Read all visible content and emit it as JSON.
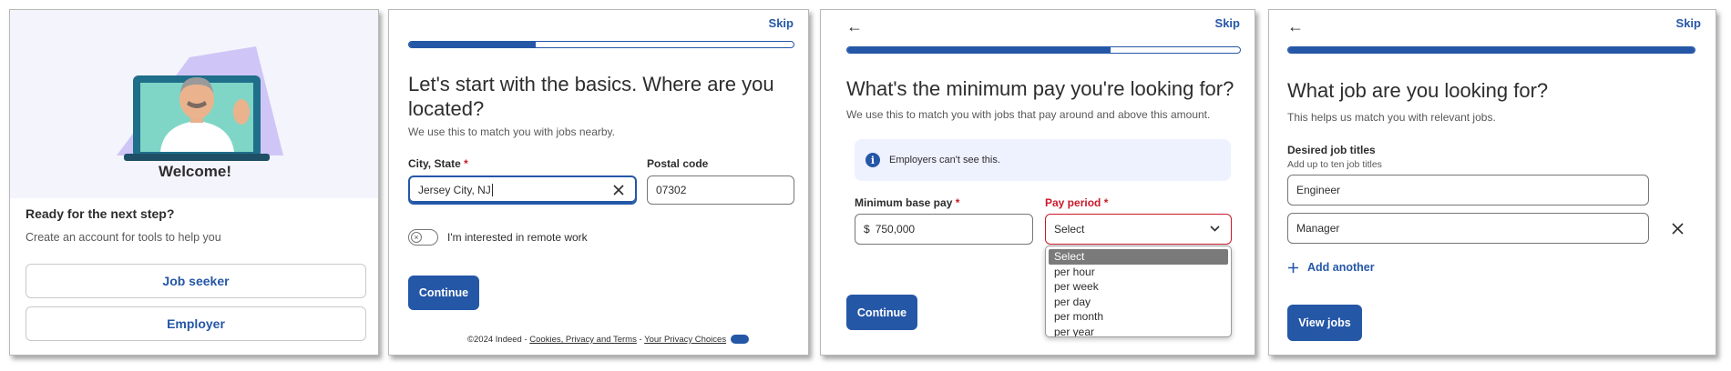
{
  "panel1": {
    "welcome": "Welcome!",
    "heading": "Ready for the next step?",
    "subtext": "Create an account for tools to help you",
    "btn_job_seeker": "Job seeker",
    "btn_employer": "Employer"
  },
  "panel2": {
    "skip": "Skip",
    "progress": 0.33,
    "title": "Let's start with the basics. Where are you located?",
    "subtitle": "We use this to match you with jobs nearby.",
    "city_label": "City, State",
    "city_value": "Jersey City, NJ",
    "postal_label": "Postal code",
    "postal_value": "07302",
    "remote_label": "I'm interested in remote work",
    "continue": "Continue",
    "footer_copy": "©2024 Indeed -",
    "footer_link1": "Cookies, Privacy and Terms",
    "footer_sep": "-",
    "footer_link2": "Your Privacy Choices"
  },
  "panel3": {
    "skip": "Skip",
    "progress": 0.67,
    "title": "What's the minimum pay you're looking for?",
    "subtitle": "We use this to match you with jobs that pay around and above this amount.",
    "info": "Employers can't see this.",
    "pay_label": "Minimum base pay",
    "currency": "$",
    "pay_value": "750,000",
    "period_label": "Pay period",
    "period_selected": "Select",
    "period_options": [
      "Select",
      "per hour",
      "per week",
      "per day",
      "per month",
      "per year"
    ],
    "continue": "Continue"
  },
  "panel4": {
    "skip": "Skip",
    "progress": 1.0,
    "title": "What job are you looking for?",
    "subtitle": "This helps us match you with relevant jobs.",
    "titles_label": "Desired job titles",
    "titles_hint": "Add up to ten job titles",
    "job1": "Engineer",
    "job2": "Manager",
    "add_another": "Add another",
    "view_jobs": "View jobs"
  },
  "colors": {
    "primary": "#2557a7",
    "required": "#c91a2a",
    "error_border": "#c91a2a",
    "hero_bg": "#f4f4fc"
  }
}
